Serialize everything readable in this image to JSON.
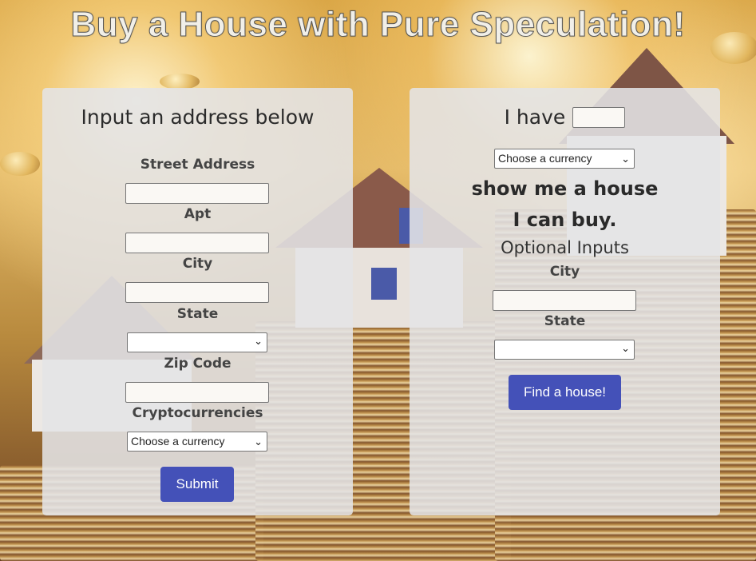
{
  "page_title": "Buy a House with Pure Speculation!",
  "left_form": {
    "heading": "Input an address below",
    "street_label": "Street Address",
    "street_value": "",
    "apt_label": "Apt",
    "apt_value": "",
    "city_label": "City",
    "city_value": "",
    "state_label": "State",
    "state_value": "",
    "zip_label": "Zip Code",
    "zip_value": "",
    "crypto_label": "Cryptocurrencies",
    "crypto_selected": "Choose a currency",
    "submit_label": "Submit"
  },
  "right_form": {
    "i_have_label": "I have",
    "amount_value": "",
    "currency_selected": "Choose a currency",
    "show_me_line1": "show me a house",
    "show_me_line2": "I can buy.",
    "optional_title": "Optional Inputs",
    "city_label": "City",
    "city_value": "",
    "state_label": "State",
    "state_value": "",
    "find_button_label": "Find a house!"
  },
  "colors": {
    "button": "#4451b8",
    "panel_background": "rgba(228,228,230,0.88)"
  }
}
